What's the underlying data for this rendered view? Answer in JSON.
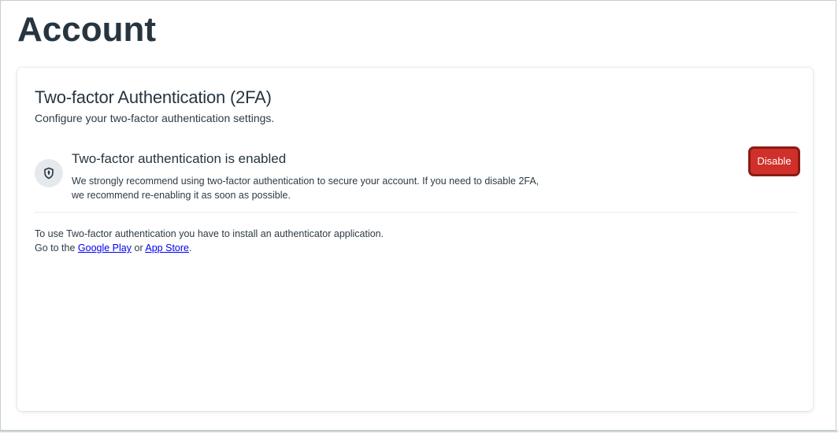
{
  "page": {
    "title": "Account"
  },
  "two_factor": {
    "title": "Two-factor Authentication (2FA)",
    "subtitle": "Configure your two-factor authentication settings.",
    "status_icon": "shield-icon",
    "status_title": "Two-factor authentication is enabled",
    "status_desc_line1": "We strongly recommend using two-factor authentication to secure your account. If you need to disable 2FA,",
    "status_desc_line2": "we recommend re-enabling it as soon as possible.",
    "disable_label": "Disable",
    "disable_color": "#cf302a",
    "info_line1": "To use Two-factor authentication you have to install an authenticator application.",
    "info_prefix": "Go to the ",
    "google_play_label": "Google Play",
    "info_or": " or ",
    "app_store_label": "App Store",
    "info_suffix": "."
  }
}
